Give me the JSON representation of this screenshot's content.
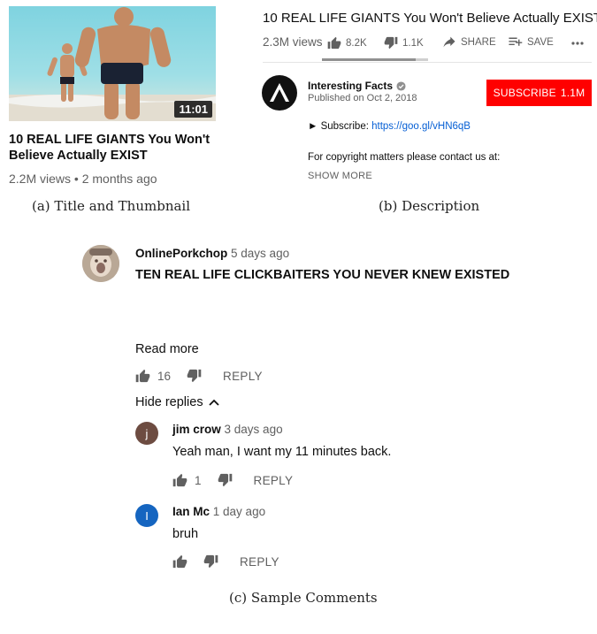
{
  "panel_a": {
    "duration": "11:01",
    "title": "10 REAL LIFE GIANTS You Won't Believe Actually EXIST",
    "meta": "2.2M views • 2 months ago",
    "caption": "(a) Title and Thumbnail"
  },
  "panel_b": {
    "title": "10 REAL LIFE GIANTS You Won't Believe Actually EXIST",
    "views": "2.3M views",
    "likes": "8.2K",
    "dislikes": "1.1K",
    "share_label": "SHARE",
    "save_label": "SAVE",
    "like_ratio": 0.88,
    "channel_name": "Interesting Facts",
    "published": "Published on Oct 2, 2018",
    "subscribe_label": "SUBSCRIBE",
    "subscriber_count": "1.1M",
    "subscribe_prefix": "► Subscribe: ",
    "subscribe_link": "https://goo.gl/vHN6qB",
    "copyright_line": "For copyright matters please contact us at:",
    "show_more": "SHOW MORE",
    "caption": "(b) Description"
  },
  "panel_c": {
    "comment": {
      "author": "OnlinePorkchop",
      "when": "5 days ago",
      "text": "TEN REAL LIFE CLICKBAITERS YOU NEVER KNEW EXISTED",
      "read_more": "Read more",
      "likes": "16",
      "reply_label": "REPLY",
      "hide_replies": "Hide replies"
    },
    "replies": [
      {
        "initial": "j",
        "author": "jim crow",
        "when": "3 days ago",
        "text": "Yeah man, I want my 11 minutes back.",
        "likes": "1",
        "reply_label": "REPLY"
      },
      {
        "initial": "I",
        "author": "Ian Mc",
        "when": "1 day ago",
        "text": "bruh",
        "likes": "",
        "reply_label": "REPLY"
      }
    ],
    "caption": "(c) Sample Comments"
  },
  "colors": {
    "subscribe_red": "#ff0000",
    "link_blue": "#065fd4",
    "jim_avatar": "#6d4c41",
    "ian_avatar": "#1565c0"
  }
}
